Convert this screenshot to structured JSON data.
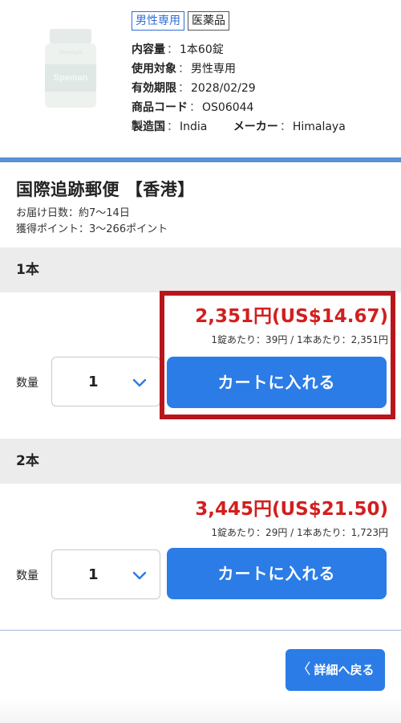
{
  "product": {
    "image_alt": "product-bottle",
    "image_text": {
      "brand": "Himalaya",
      "name": "Speman"
    },
    "tags": [
      "男性専用",
      "医薬品"
    ],
    "specs": [
      {
        "key": "内容量",
        "value": "1本60錠"
      },
      {
        "key": "使用対象",
        "value": "男性専用"
      },
      {
        "key": "有効期限",
        "value": "2028/02/29"
      },
      {
        "key": "商品コード",
        "value": "OS06044"
      }
    ],
    "origin_key": "製造国",
    "origin_value": "India",
    "maker_key": "メーカー",
    "maker_value": "Himalaya"
  },
  "shipping": {
    "title": "国際追跡郵便 【香港】",
    "delivery_days": "お届け日数：約7〜14日",
    "points": "獲得ポイント：3〜266ポイント"
  },
  "groups": [
    {
      "header": "1本",
      "price": "2,351円(US$14.67)",
      "unit": "1錠あたり：39円 / 1本あたり：2,351円",
      "qty_label": "数量",
      "qty_value": "1",
      "cart_label": "カートに入れる",
      "highlighted": true
    },
    {
      "header": "2本",
      "price": "3,445円(US$21.50)",
      "unit": "1錠あたり：29円 / 1本あたり：1,723円",
      "qty_label": "数量",
      "qty_value": "1",
      "cart_label": "カートに入れる",
      "highlighted": false
    }
  ],
  "back_button": {
    "label": "詳細へ戻る",
    "icon": "chevron-left-icon"
  },
  "colors": {
    "accent": "#2b7ce6",
    "price": "#d21f1f",
    "highlight": "#b8161c",
    "rule": "#5b8fd6"
  }
}
